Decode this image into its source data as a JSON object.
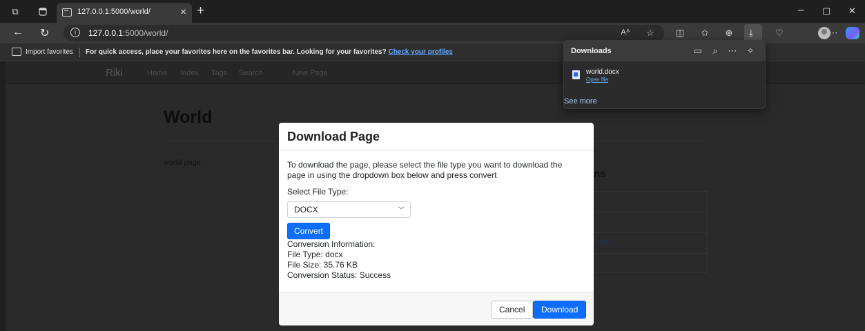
{
  "browser": {
    "tab_title": "127.0.0.1:5000/world/",
    "tab_close": "×",
    "new_tab": "+",
    "url_host": "127.0.0.1",
    "url_rest": ":5000/world/",
    "window_controls": {
      "minimize": "–",
      "restore": "▢",
      "close": "✕"
    }
  },
  "favorites_bar": {
    "import_label": "Import favorites",
    "message": "For quick access, place your favorites here on the favorites bar. Looking for your favorites?",
    "link": "Check your profiles"
  },
  "page": {
    "brand": "Riki",
    "nav": [
      "Home",
      "Index",
      "Tags",
      "Search",
      "New Page"
    ],
    "title": "World",
    "body": "world page",
    "side_heading_fragment": "ns",
    "side_link_fragment": "d Page"
  },
  "modal": {
    "title": "Download Page",
    "description": "To download the page, please select the file type you want to download the page in using the dropdown box below and press convert",
    "select_label": "Select File Type:",
    "selected_type": "DOCX",
    "convert_label": "Convert",
    "info": {
      "heading": "Conversion Information:",
      "file_type": "File Type: docx",
      "file_size": "File Size: 35.76 KB",
      "status": "Conversion Status: Success"
    },
    "cancel_label": "Cancel",
    "download_label": "Download"
  },
  "downloads": {
    "title": "Downloads",
    "file_name": "world.docx",
    "open_file": "Open file",
    "see_more": "See more"
  },
  "colors": {
    "primary_button": "#0d6efd",
    "link_blue": "#64a8ff",
    "browser_dark": "#1f1f1f"
  }
}
